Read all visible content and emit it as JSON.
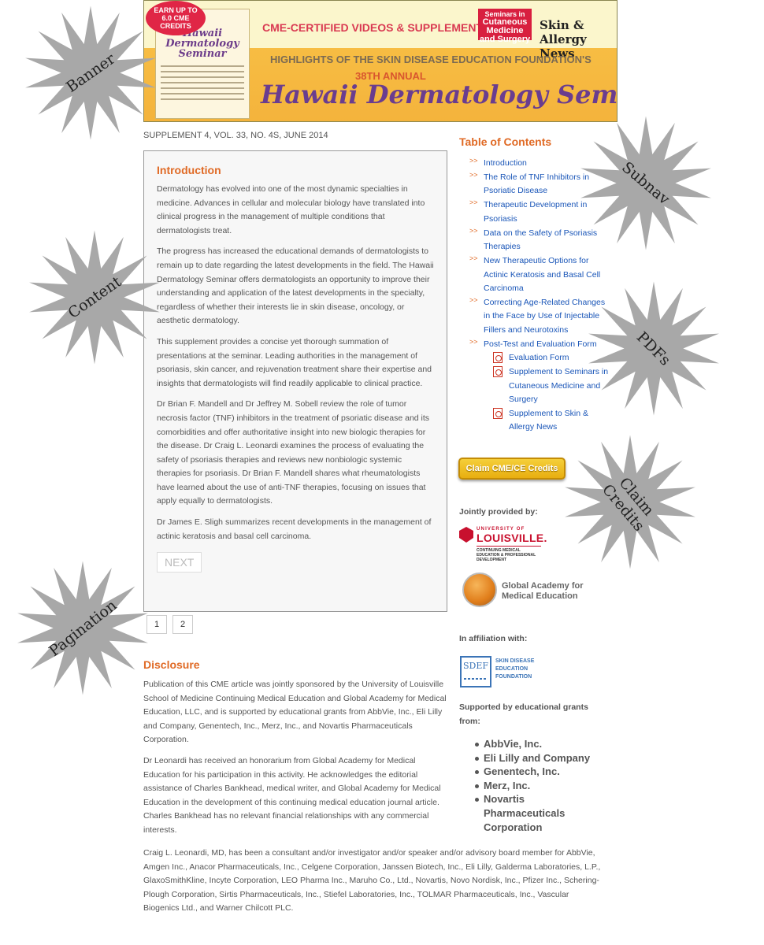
{
  "banner": {
    "badge_line1": "EARN UP TO",
    "badge_line2": "6.0 CME",
    "badge_line3": "CREDITS",
    "cover_title": "Hawaii Dermatology Seminar",
    "cme_text": "CME-CERTIFIED VIDEOS & SUPPLEMENT TO",
    "seminars_line1": "Seminars in",
    "seminars_line2": "Cutaneous",
    "seminars_line3": "Medicine",
    "seminars_line4": "and Surgery",
    "skin_allergy": "Skin & Allergy News",
    "highlights": "HIGHLIGHTS OF THE SKIN DISEASE EDUCATION FOUNDATION'S",
    "annual": "38TH ANNUAL",
    "hawaii": "Hawaii Dermatology Seminar"
  },
  "supplement_line": "SUPPLEMENT 4, VOL. 33, NO. 4S, JUNE 2014",
  "content": {
    "heading": "Introduction",
    "paragraphs": [
      "Dermatology has evolved into one of the most dynamic specialties in medicine. Advances in cellular and molecular biology have translated into clinical progress in the management of multiple conditions that dermatologists treat.",
      "The progress has increased the educational demands of dermatologists to remain up to date regarding the latest developments in the field. The Hawaii Dermatology Seminar offers dermatologists an opportunity to improve their understanding and application of the latest developments in the specialty, regardless of whether their interests lie in skin disease, oncology, or aesthetic dermatology.",
      "This supplement provides a concise yet thorough summation of presentations at the seminar. Leading authorities in the management of psoriasis, skin cancer, and rejuvenation treatment share their expertise and insights that dermatologists will find readily applicable to clinical practice.",
      "Dr Brian F. Mandell and Dr Jeffrey M. Sobell review the role of tumor necrosis factor (TNF) inhibitors in the treatment of psoriatic disease and its comorbidities and offer authoritative insight into new biologic therapies for the disease. Dr Craig L. Leonardi examines the process of evaluating the safety of psoriasis therapies and reviews new nonbiologic systemic therapies for psoriasis. Dr Brian F. Mandell shares what rheumatologists have learned about the use of anti-TNF therapies, focusing on issues that apply equally to dermatologists.",
      "Dr James E. Sligh summarizes recent developments in the management of actinic keratosis and basal cell carcinoma."
    ],
    "next_label": "NEXT"
  },
  "pagination": [
    "1",
    "2"
  ],
  "disclosure": {
    "heading": "Disclosure",
    "paragraphs": [
      "Publication of this CME article was jointly sponsored by the University of Louisville School of Medicine Continuing Medical Education and Global Academy for Medical Education, LLC, and is supported by educational grants from AbbVie, Inc., Eli Lilly and Company, Genentech, Inc., Merz, Inc., and Novartis Pharmaceuticals Corporation.",
      "Dr Leonardi has received an honorarium from Global Academy for Medical Education for his participation in this activity. He acknowledges the editorial assistance of Charles Bankhead, medical writer, and Global Academy for Medical Education in the development of this continuing medical education journal article. Charles Bankhead has no relevant financial relationships with any commercial interests."
    ],
    "wide_paragraph": "Craig L. Leonardi, MD, has been a consultant and/or investigator and/or speaker and/or advisory board member for AbbVie, Amgen Inc., Anacor Pharmaceuticals, Inc., Celgene Corporation, Janssen Biotech, Inc., Eli Lilly, Galderma Laboratories, L.P., GlaxoSmithKline, Incyte Corporation, LEO Pharma Inc., Maruho Co., Ltd., Novartis, Novo Nordisk, Inc., Pfizer Inc., Schering-Plough Corporation, Sirtis Pharmaceuticals, Inc., Stiefel Laboratories, Inc., TOLMAR Pharmaceuticals, Inc., Vascular Biogenics Ltd., and Warner Chilcott PLC."
  },
  "toc": {
    "title": "Table of Contents",
    "arrow": ">>",
    "items": [
      "Introduction",
      "The Role of TNF Inhibitors in Psoriatic Disease",
      "Therapeutic Development in Psoriasis",
      "Data on the Safety of Psoriasis Therapies",
      "New Therapeutic Options for Actinic Keratosis and Basal Cell Carcinoma",
      "Correcting Age-Related Changes in the Face by Use of Injectable Fillers and Neurotoxins",
      "Post-Test and Evaluation Form"
    ],
    "pdfs": [
      "Evaluation Form",
      "Supplement to Seminars in Cutaneous Medicine and Surgery",
      "Supplement to Skin & Allergy News"
    ]
  },
  "claim_button": "Claim CME/CE Credits",
  "sidebar": {
    "jointly": "Jointly provided by:",
    "uofl_univ": "UNIVERSITY OF",
    "uofl_name": "LOUISVILLE.",
    "uofl_sub1": "CONTINUING MEDICAL",
    "uofl_sub2": "EDUCATION & PROFESSIONAL",
    "uofl_sub3": "DEVELOPMENT",
    "gamed_line1": "Global Academy for",
    "gamed_line2": "Medical Education",
    "affiliation": "In affiliation with:",
    "sdef_abbr": "SDEF",
    "sdef_line1": "SKIN DISEASE",
    "sdef_line2": "EDUCATION",
    "sdef_line3": "FOUNDATION",
    "supported": "Supported by educational grants from:",
    "sponsors": [
      "AbbVie, Inc.",
      "Eli Lilly and Company",
      "Genentech, Inc.",
      "Merz, Inc.",
      "Novartis Pharmaceuticals Corporation"
    ]
  },
  "callouts": {
    "banner": "Banner",
    "subnav": "Subnav",
    "content": "Content",
    "pdfs": "PDFs",
    "claim_line1": "Claim",
    "claim_line2": "Credits",
    "pagination": "Pagination"
  },
  "colors": {
    "accent_orange": "#e06a25",
    "link_blue": "#1a56b8",
    "burst_gray": "#a8a8a8"
  }
}
